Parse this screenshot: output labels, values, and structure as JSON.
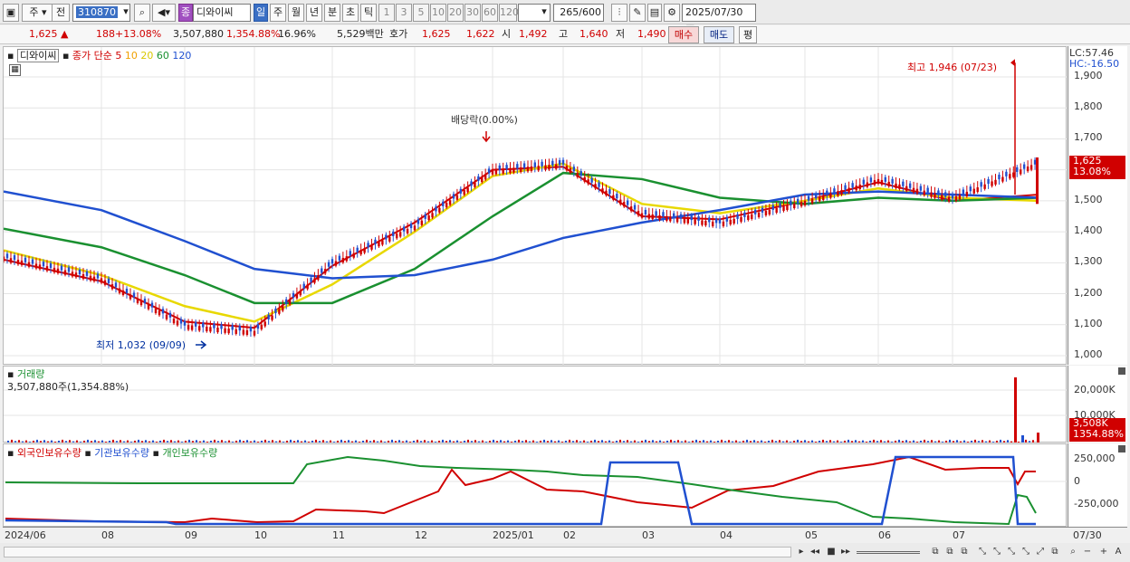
{
  "toolbar": {
    "market": "주",
    "prev": "전",
    "code": "310870",
    "name_badge": "종",
    "stock_name": "디와이씨",
    "periods": [
      "일",
      "주",
      "월",
      "년",
      "분",
      "초",
      "틱"
    ],
    "intervals": [
      "1",
      "3",
      "5",
      "10",
      "20",
      "30",
      "60",
      "120"
    ],
    "count": "265",
    "count_total": "/600",
    "date": "2025/07/30"
  },
  "quote": {
    "price": "1,625",
    "change": "188",
    "change_rate": "+13.08%",
    "volume": "3,507,880",
    "volume_rate": "1,354.88%",
    "turnover": "16.96%",
    "amount": "5,529백만",
    "hoga_label": "호가",
    "ask": "1,625",
    "bid": "1,622",
    "open_label": "시",
    "open": "1,492",
    "high_label": "고",
    "high": "1,640",
    "low_label": "저",
    "low": "1,490",
    "buy_label": "매수",
    "sell_label": "매도",
    "eval_label": "평"
  },
  "main": {
    "title": "디와이씨",
    "legend_prefix": "종가 단순",
    "ma": [
      {
        "period": "5",
        "color": "#d00000"
      },
      {
        "period": "10",
        "color": "#f0a000"
      },
      {
        "period": "20",
        "color": "#e8d800"
      },
      {
        "period": "60",
        "color": "#1a9030"
      },
      {
        "period": "120",
        "color": "#2050d0"
      }
    ],
    "annotation_high": "최고 1,946 (07/23)",
    "annotation_low": "최저 1,032 (09/09)",
    "annotation_dividend": "배당락(0.00%)",
    "lc": "LC:57.46",
    "hc": "HC:-16.50",
    "current_price": "1,625",
    "current_rate": "13.08%",
    "yticks": [
      "1,900",
      "1,800",
      "1,700",
      "1,600",
      "1,500",
      "1,400",
      "1,300",
      "1,200",
      "1,100",
      "1,000"
    ]
  },
  "volume": {
    "title": "거래량",
    "value": "3,507,880주(1,354.88%)",
    "yticks": [
      "20,000K",
      "10,000K"
    ],
    "current": "3,508K",
    "current_rate": "1354.88%"
  },
  "holdings": {
    "legend": [
      {
        "label": "외국인보유수량",
        "color": "#d00000"
      },
      {
        "label": "기관보유수량",
        "color": "#2050d0"
      },
      {
        "label": "개인보유수량",
        "color": "#1a9030"
      }
    ],
    "yticks": [
      "250,000",
      "0",
      "-250,000"
    ]
  },
  "xaxis": {
    "labels": [
      "2024/06",
      "08",
      "09",
      "10",
      "11",
      "12",
      "2025/01",
      "02",
      "03",
      "04",
      "05",
      "06",
      "07"
    ],
    "last": "07/30"
  },
  "chart_data": {
    "type": "line",
    "title": "디와이씨",
    "ylim": [
      1000,
      1946
    ],
    "x": [
      "2024/06",
      "08",
      "09",
      "10",
      "11",
      "12",
      "2025/01",
      "02",
      "03",
      "04",
      "05",
      "06",
      "07",
      "07/30"
    ],
    "series": [
      {
        "name": "종가",
        "values": [
          1320,
          1250,
          1100,
          1080,
          1300,
          1420,
          1600,
          1620,
          1460,
          1430,
          1500,
          1570,
          1510,
          1625
        ]
      },
      {
        "name": "5",
        "values": [
          1310,
          1240,
          1110,
          1090,
          1290,
          1430,
          1600,
          1610,
          1450,
          1440,
          1500,
          1560,
          1500,
          1520
        ]
      },
      {
        "name": "20",
        "values": [
          1340,
          1260,
          1160,
          1110,
          1230,
          1400,
          1580,
          1620,
          1490,
          1460,
          1500,
          1540,
          1510,
          1500
        ]
      },
      {
        "name": "60",
        "values": [
          1410,
          1350,
          1260,
          1170,
          1170,
          1280,
          1450,
          1590,
          1570,
          1510,
          1490,
          1510,
          1500,
          1510
        ]
      },
      {
        "name": "120",
        "values": [
          1530,
          1470,
          1370,
          1280,
          1250,
          1260,
          1310,
          1380,
          1430,
          1470,
          1520,
          1530,
          1520,
          1510
        ]
      }
    ]
  }
}
